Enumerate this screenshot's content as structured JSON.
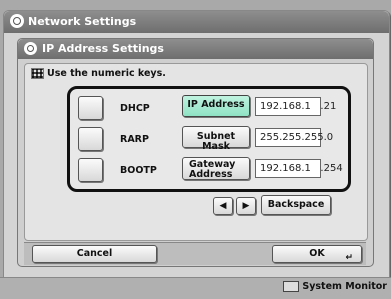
{
  "window": {
    "title": "Network Settings"
  },
  "dialog": {
    "title": "IP Address Settings"
  },
  "hint": "Use the numeric keys.",
  "protocols": [
    {
      "label": "DHCP"
    },
    {
      "label": "RARP"
    },
    {
      "label": "BOOTP"
    }
  ],
  "fields": [
    {
      "label": "IP Address",
      "value": "192.168.1   .21",
      "selected": true
    },
    {
      "label": "Subnet Mask",
      "value": "255.255.255.0",
      "selected": false
    },
    {
      "label_line1": "Gateway",
      "label_line2": "Address",
      "value": "192.168.1   .254",
      "selected": false
    }
  ],
  "nav": {
    "left": "◀",
    "right": "▶",
    "backspace": "Backspace"
  },
  "footer": {
    "cancel": "Cancel",
    "ok": "OK",
    "ok_icon": "↵"
  },
  "status": {
    "system_monitor": "System Monitor"
  },
  "colors": {
    "selected": "#9fe9cf",
    "titlebar": "#7a7a7a"
  }
}
